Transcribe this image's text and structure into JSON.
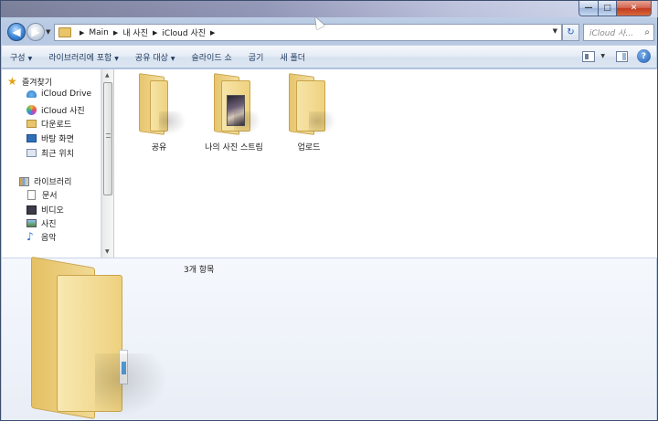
{
  "window": {
    "min_glyph": "—",
    "max_glyph": "□",
    "close_glyph": "✕"
  },
  "address": {
    "back_glyph": "◀",
    "forward_glyph": "▶",
    "crumbs": [
      "Main",
      "내 사진",
      "iCloud 사진"
    ],
    "search_placeholder": "iCloud 사..."
  },
  "toolbar": {
    "organize": "구성",
    "include_library": "라이브러리에 포함",
    "share_with": "공유 대상",
    "slideshow": "슬라이드 쇼",
    "burn": "굽기",
    "new_folder": "새 폴더",
    "help": "?"
  },
  "nav": {
    "favorites_label": "즐겨찾기",
    "favorites": [
      {
        "label": "iCloud Drive",
        "icon": "icloud-drive-icon"
      },
      {
        "label": "iCloud 사진",
        "icon": "icloud-photos-icon"
      },
      {
        "label": "다운로드",
        "icon": "downloads-folder-icon"
      },
      {
        "label": "바탕 화면",
        "icon": "desktop-icon"
      },
      {
        "label": "최근 위치",
        "icon": "recent-places-icon"
      }
    ],
    "libraries_label": "라이브러리",
    "libraries": [
      {
        "label": "문서",
        "icon": "documents-icon"
      },
      {
        "label": "비디오",
        "icon": "videos-icon"
      },
      {
        "label": "사진",
        "icon": "pictures-icon"
      },
      {
        "label": "음악",
        "icon": "music-icon"
      }
    ]
  },
  "content": {
    "items": [
      {
        "label": "공유",
        "icon": "folder-shared-icon"
      },
      {
        "label": "나의 사진 스트림",
        "icon": "folder-photostream-icon"
      },
      {
        "label": "업로드",
        "icon": "folder-upload-icon"
      }
    ]
  },
  "details": {
    "count_text": "3개 항목"
  }
}
